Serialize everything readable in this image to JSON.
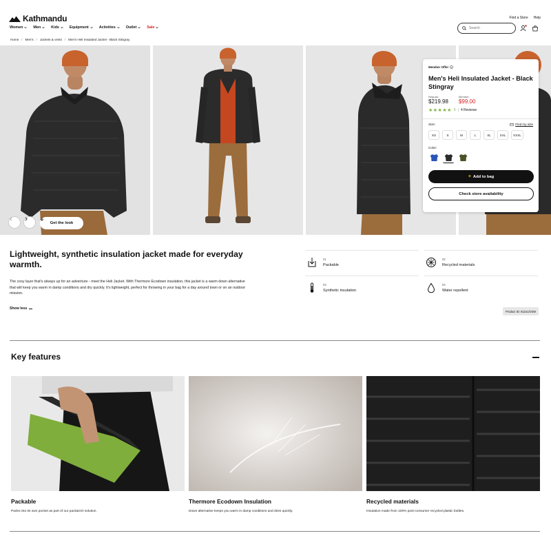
{
  "brand": {
    "name": "Kathmandu"
  },
  "utility": {
    "find_store": "Find a Store",
    "help": "Help"
  },
  "nav": [
    {
      "label": "Women",
      "has_menu": true
    },
    {
      "label": "Men",
      "has_menu": true
    },
    {
      "label": "Kids",
      "has_menu": true
    },
    {
      "label": "Equipment",
      "has_menu": true
    },
    {
      "label": "Activities",
      "has_menu": true
    },
    {
      "label": "Outlet",
      "has_menu": true
    },
    {
      "label": "Sale",
      "has_menu": true
    }
  ],
  "search": {
    "placeholder": "Search"
  },
  "breadcrumb": [
    "Home",
    "Men's",
    "Jackets & vests",
    "Men's Heli Insulated Jacket - Black Stingray"
  ],
  "gallery": {
    "get_the_look": "Get the look"
  },
  "product": {
    "member_offer": "Member Offer",
    "title": "Men's Heli Insulated Jacket - Black Stingray",
    "regular_label": "Regular:",
    "regular_price": "$219.98",
    "member_label": "Member:",
    "member_price": "$99.00",
    "stars": "★★★★★",
    "rating": "5",
    "reviews": "4 Reviews",
    "size_label": "Size:",
    "find_size": "Find my size",
    "sizes": [
      "XS",
      "S",
      "M",
      "L",
      "XL",
      "XXL",
      "XXXL"
    ],
    "color_label": "Color:",
    "swatch_colors": [
      "#2a55b8",
      "#2b2b2b",
      "#4b5224"
    ],
    "add_to_bag": "Add to bag",
    "check_store": "Check store availability"
  },
  "description": {
    "heading": "Lightweight, synthetic insulation jacket made for everyday warmth.",
    "body": "The cosy layer that's always up for an adventure - meet the Heli Jacket. With Thermore Ecodown insulation, this jacket is a warm down alternative that will keep you warm in damp conditions and dry quickly. It's lightweight, perfect for throwing in your bag for a day around town or on an outdoor mission.",
    "show_less": "Show less",
    "product_id": "Product ID: 81151/O4W"
  },
  "highlights": [
    {
      "num": "01",
      "label": "Packable",
      "icon": "packable-icon"
    },
    {
      "num": "02",
      "label": "Recycled materials",
      "icon": "recycled-icon"
    },
    {
      "num": "03",
      "label": "Synthetic insulation",
      "icon": "thermometer-icon"
    },
    {
      "num": "04",
      "label": "Water repellent",
      "icon": "water-drop-icon"
    }
  ],
  "key_features": {
    "title": "Key features",
    "cards": [
      {
        "title": "Packable",
        "text": "Packs into its own pocket as part of our pack&GO solution."
      },
      {
        "title": "Thermore Ecodown Insulation",
        "text": "Down alternative keeps you warm in damp conditions and dries quickly."
      },
      {
        "title": "Recycled materials",
        "text": "Insulation made from 100% post-consumer recycled plastic bottles."
      }
    ]
  },
  "colors": {
    "sale_red": "#d81e1e",
    "rating_green": "#7bb33a",
    "accent_black": "#111111"
  }
}
